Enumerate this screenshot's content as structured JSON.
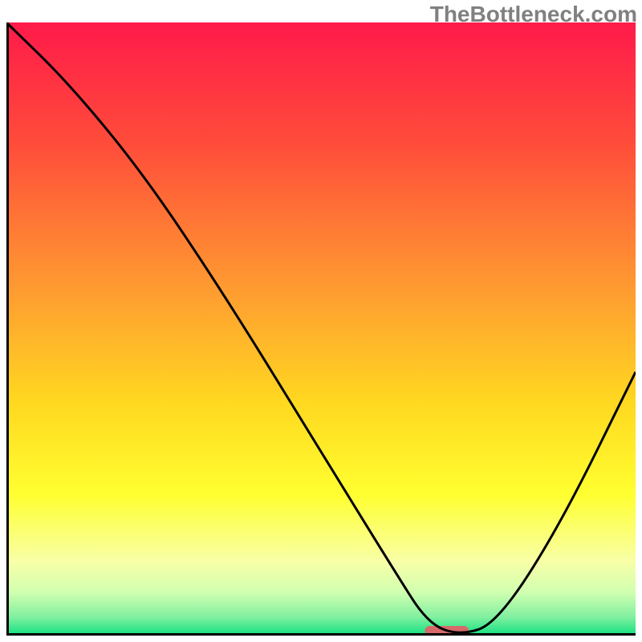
{
  "watermark": "TheBottleneck.com",
  "chart_data": {
    "type": "line",
    "title": "",
    "xlabel": "",
    "ylabel": "",
    "xlim": [
      0,
      100
    ],
    "ylim": [
      0,
      100
    ],
    "gradient_stops": [
      {
        "offset": 0.0,
        "color": "#ff1a4a"
      },
      {
        "offset": 0.2,
        "color": "#ff4d3a"
      },
      {
        "offset": 0.45,
        "color": "#ffa030"
      },
      {
        "offset": 0.62,
        "color": "#ffd820"
      },
      {
        "offset": 0.77,
        "color": "#ffff30"
      },
      {
        "offset": 0.88,
        "color": "#f8ffa8"
      },
      {
        "offset": 0.93,
        "color": "#d0ffb0"
      },
      {
        "offset": 0.97,
        "color": "#80f0a0"
      },
      {
        "offset": 1.0,
        "color": "#10e080"
      }
    ],
    "series": [
      {
        "name": "bottleneck-curve",
        "x": [
          0,
          10,
          22,
          35,
          50,
          62,
          67,
          72,
          78,
          88,
          100
        ],
        "y": [
          100,
          90,
          75,
          55,
          30,
          10,
          2,
          0,
          2,
          18,
          43
        ]
      }
    ],
    "marker": {
      "name": "optimal-marker",
      "x_center": 70,
      "width": 7,
      "color": "#d66a6a"
    },
    "axes_color": "#000000",
    "axes_width": 3
  }
}
